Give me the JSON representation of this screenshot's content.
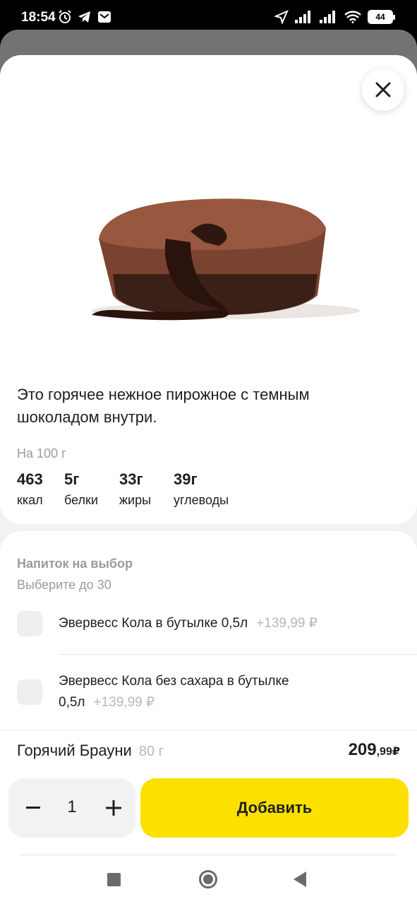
{
  "status_bar": {
    "time": "18:54",
    "battery": "44"
  },
  "product": {
    "description": "Это горячее нежное пирожное с темным шоколадом внутри.",
    "per_label": "На 100 г",
    "nutrition": [
      {
        "value": "463",
        "unit": "ккал"
      },
      {
        "value": "5г",
        "unit": "белки"
      },
      {
        "value": "33г",
        "unit": "жиры"
      },
      {
        "value": "39г",
        "unit": "углеводы"
      }
    ]
  },
  "options": {
    "title": "Напиток на выбор",
    "subtitle": "Выберите до 30",
    "items": [
      {
        "label": "Эвервесс Кола в бутылке 0,5л",
        "price": "+139,99 ₽",
        "checked": false
      },
      {
        "label_line1": "Эвервесс Кола без сахара в бутылке",
        "label_line2": "0,5л",
        "price": "+139,99 ₽",
        "checked": false
      }
    ]
  },
  "order": {
    "name": "Горячий Брауни",
    "weight": "80 г",
    "price_main": "209",
    "price_fraction": ",99",
    "currency": "₽",
    "quantity": "1",
    "minus": "−",
    "plus": "+",
    "add_label": "Добавить"
  },
  "icons": {
    "close": "close-icon",
    "minus": "minus-icon",
    "plus": "plus-icon"
  },
  "colors": {
    "accent": "#fce000",
    "text": "#21201f",
    "muted": "#9e9b98",
    "price_muted": "#b9b6b3"
  }
}
